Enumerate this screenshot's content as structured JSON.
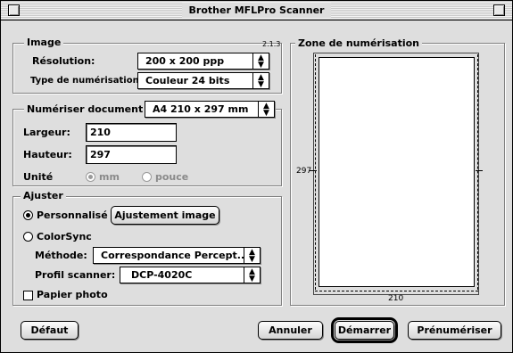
{
  "window": {
    "title": "Brother MFLPro Scanner",
    "version": "2.1.3"
  },
  "image_group": {
    "label": "Image",
    "resolution_label": "Résolution:",
    "resolution_value": "200 x 200 ppp",
    "scan_type_label": "Type de numérisation:",
    "scan_type_value": "Couleur 24 bits"
  },
  "document_group": {
    "label": "Numériser document",
    "size_value": "A4 210 x 297 mm",
    "width_label": "Largeur:",
    "width_value": "210",
    "height_label": "Hauteur:",
    "height_value": "297",
    "unit_label": "Unité",
    "unit_mm": "mm",
    "unit_inch": "pouce"
  },
  "adjust_group": {
    "label": "Ajuster",
    "custom_label": "Personnalisé",
    "adjust_button": "Ajustement image",
    "colorsync_label": "ColorSync",
    "method_label": "Méthode:",
    "method_value": "Correspondance Percept...",
    "profile_label": "Profil scanner:",
    "profile_value": "DCP-4020C",
    "photo_paper_label": "Papier photo"
  },
  "scan_area": {
    "label": "Zone de numérisation",
    "height_mark": "297",
    "width_mark": "210"
  },
  "buttons": {
    "default": "Défaut",
    "cancel": "Annuler",
    "start": "Démarrer",
    "prescan": "Prénumériser"
  },
  "icons": {
    "popup_arrows": "up-down-arrows-icon"
  }
}
